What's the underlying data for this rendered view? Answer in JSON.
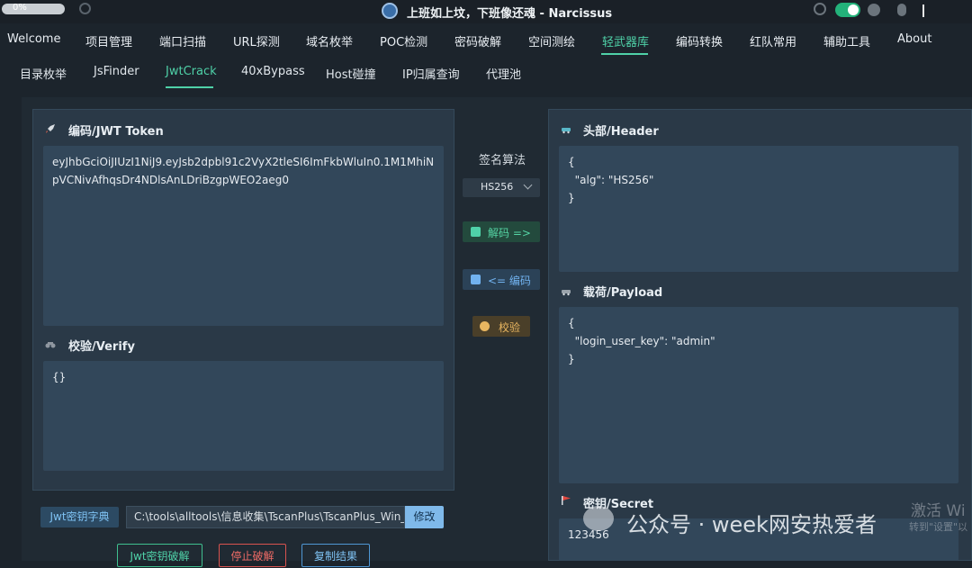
{
  "titlebar": {
    "progress_label": "0%",
    "progress_fraction": 0.0,
    "title": "上班如上坟，下班像还魂 - Narcissus"
  },
  "menu": [
    "Welcome",
    "项目管理",
    "端口扫描",
    "URL探测",
    "域名枚举",
    "POC检测",
    "密码破解",
    "空间测绘",
    "轻武器库",
    "编码转换",
    "红队常用",
    "辅助工具",
    "About"
  ],
  "menu_active": "轻武器库",
  "subtabs": [
    "目录枚举",
    "JsFinder",
    "JwtCrack",
    "40xBypass",
    "Host碰撞",
    "IP归属查询",
    "代理池"
  ],
  "subtab_active": "JwtCrack",
  "token_panel": {
    "title": "编码/JWT Token",
    "value": "eyJhbGciOiJIUzI1NiJ9.eyJsb2dpbl91c2VyX2tleSI6ImFkbWluIn0.1M1MhiNpVCNivAfhqsDr4NDlsAnLDriBzgpWEO2aeg0"
  },
  "verify_panel": {
    "title": "校验/Verify",
    "value": "{}"
  },
  "header_panel": {
    "title": "头部/Header",
    "value": "{\n  \"alg\": \"HS256\"\n}"
  },
  "payload_panel": {
    "title": "载荷/Payload",
    "value": "{\n  \"login_user_key\": \"admin\"\n}"
  },
  "secret_panel": {
    "title": "密钥/Secret",
    "value": "123456"
  },
  "middle": {
    "algo_label": "签名算法",
    "algo_value": "HS256",
    "decode_label": "解码 =>",
    "encode_label": "<= 编码",
    "verify_label": "校验"
  },
  "bottom": {
    "dict_label": "Jwt密钥字典",
    "path_value": "C:\\tools\\alltools\\信息收集\\TscanPlus\\TscanPlus_Win_A",
    "modify_label": "修改",
    "crack_label": "Jwt密钥破解",
    "stop_label": "停止破解",
    "copy_label": "复制结果"
  },
  "overlay": {
    "activate_title": "激活 Wi",
    "activate_sub": "转到\"设置\"以",
    "watermark": "公众号 · week网安热爱者"
  },
  "colors": {
    "accent": "#4fd1a8",
    "panel": "#2a3947",
    "background": "#1c242c"
  },
  "icons": [
    "gear-icon",
    "app-logo-icon",
    "settings-icon",
    "theme-toggle",
    "github-icon",
    "bug-icon",
    "rocket-icon",
    "binoculars-icon",
    "car-icon",
    "flag-icon",
    "key-icon",
    "lock-icon",
    "check-circle-icon",
    "chevron-down-icon",
    "wechat-icon"
  ]
}
